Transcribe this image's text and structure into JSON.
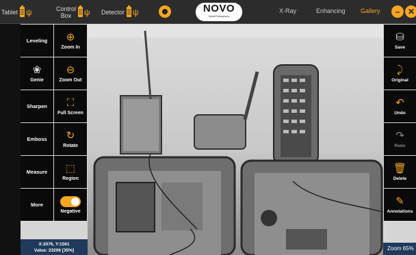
{
  "topbar": {
    "tablet_label": "Tablet",
    "control_box_label_line1": "Control",
    "control_box_label_line2": "Box",
    "detector_label": "Detector",
    "logo_brand": "NOVO",
    "logo_sub": "Digital Radiography",
    "tabs": [
      "X-Ray",
      "Enhancing",
      "Gallery"
    ],
    "active_tab": "Gallery",
    "minimize_icon": "minimize-icon",
    "close_icon": "close-icon",
    "close_glyph": "✕",
    "accent_color": "#f5a623"
  },
  "left_tools": [
    {
      "label": "Leveling"
    },
    {
      "label": "Genie",
      "icon": "genie-icon"
    },
    {
      "label": "Sharpen"
    },
    {
      "label": "Emboss"
    },
    {
      "label": "Measure"
    },
    {
      "label": "More"
    }
  ],
  "left_tools_b": [
    {
      "label": "Zoom In",
      "icon": "zoom-in-icon"
    },
    {
      "label": "Zoom Out",
      "icon": "zoom-out-icon"
    },
    {
      "label": "Full Screen",
      "icon": "full-screen-icon"
    },
    {
      "label": "Rotate",
      "icon": "rotate-icon"
    },
    {
      "label": "Region",
      "icon": "region-icon"
    },
    {
      "label": "Negative",
      "icon": "toggle-icon"
    }
  ],
  "right_tools": [
    {
      "label": "Save",
      "icon": "save-icon"
    },
    {
      "label": "Original",
      "icon": "original-icon"
    },
    {
      "label": "Undo",
      "icon": "undo-icon"
    },
    {
      "label": "Redo",
      "icon": "redo-icon",
      "disabled": true
    },
    {
      "label": "Delete",
      "icon": "trash-icon"
    },
    {
      "label": "Annotations",
      "icon": "annotations-icon"
    }
  ],
  "status": {
    "coords": "X:2076, Y:1561",
    "value": "Value: 23206 [35%]"
  },
  "zoom": "Zoom 65%"
}
